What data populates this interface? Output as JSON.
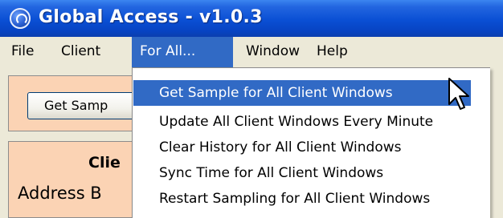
{
  "window": {
    "title": "Global Access - v1.0.3",
    "icon": "globe-phone-icon",
    "accent_color": "#0a4fd4"
  },
  "menubar": {
    "items": [
      {
        "label": "File"
      },
      {
        "label": "Client"
      },
      {
        "label": "For All..."
      },
      {
        "label": "Window"
      },
      {
        "label": "Help"
      }
    ],
    "active": "For All..."
  },
  "panel": {
    "button_label": "Get Samp",
    "heading": "Clie",
    "address_label": "Address B",
    "background_color": "#fbd3b4"
  },
  "dropdown": {
    "items": [
      {
        "label": "Get Sample for All Client Windows"
      },
      {
        "label": "Update All Client Windows Every Minute"
      },
      {
        "label": "Clear History for All Client Windows"
      },
      {
        "label": "Sync Time for All Client Windows"
      },
      {
        "label": "Restart Sampling for All Client Windows"
      }
    ],
    "highlighted": "Get Sample for All Client Windows",
    "highlight_color": "#316ac5"
  },
  "cursor": "arrow-cursor-icon"
}
